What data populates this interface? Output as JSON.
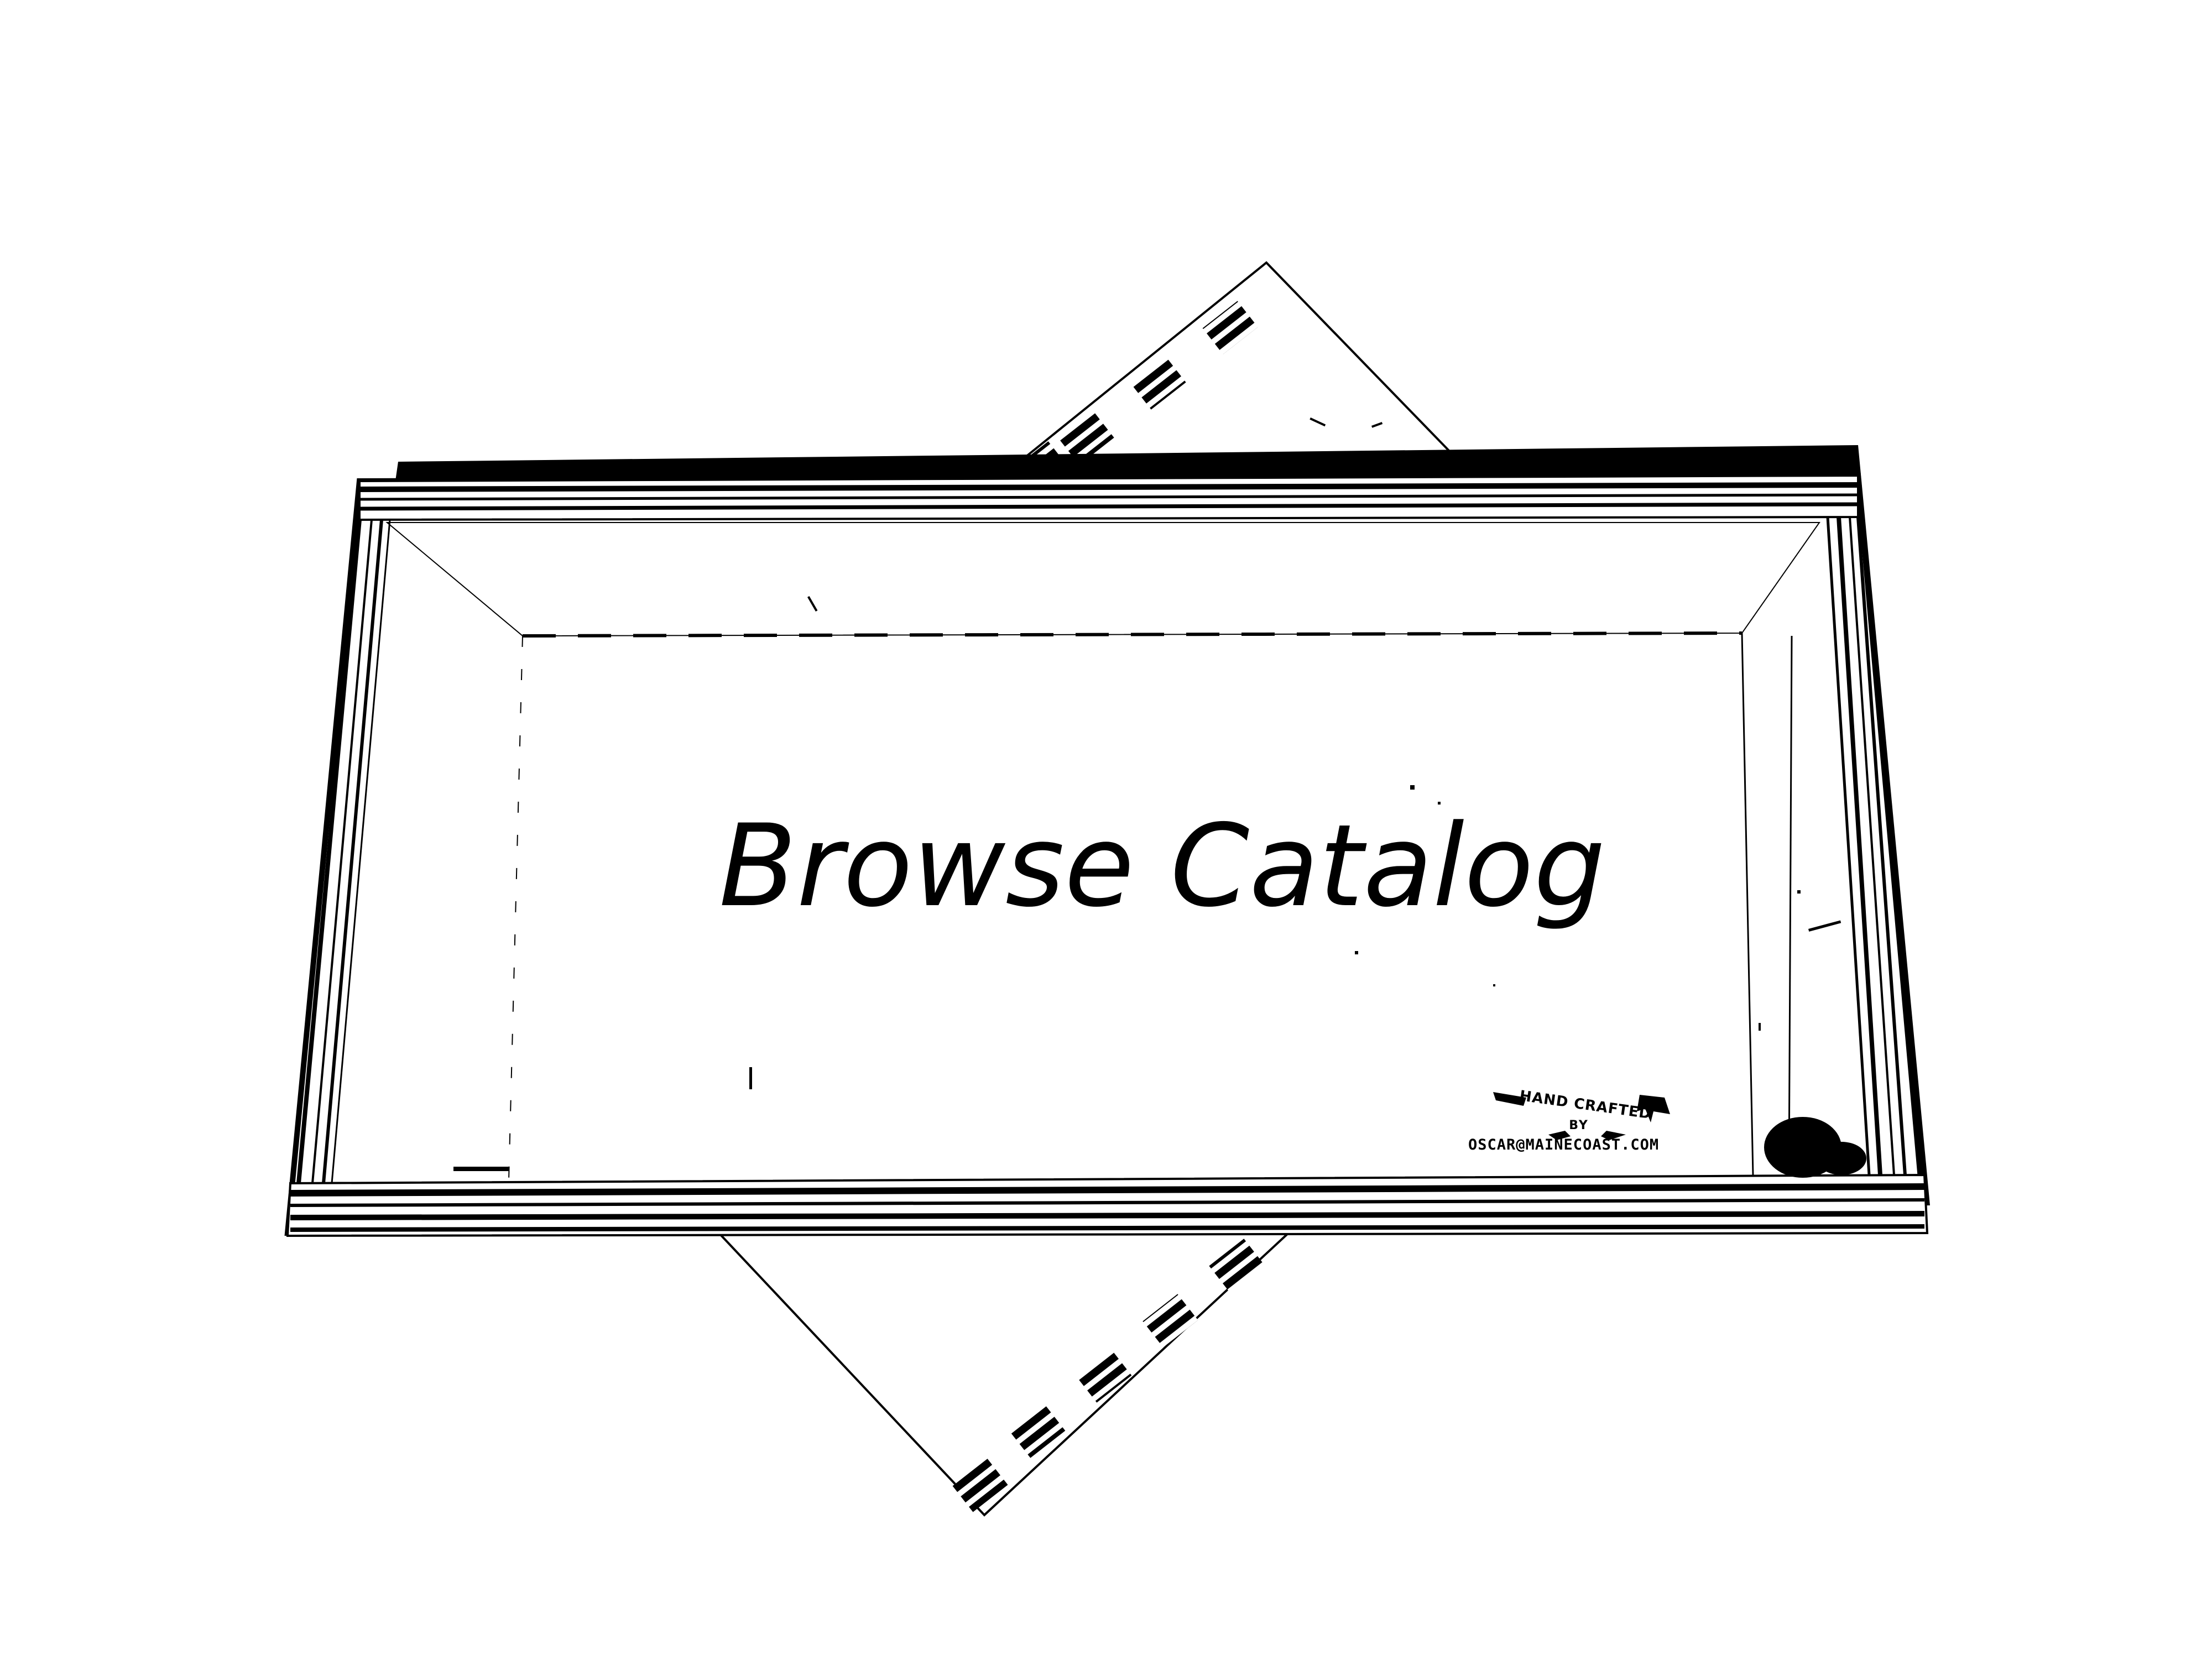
{
  "catalog_button": {
    "label": "Browse Catalog"
  },
  "maker_stamp": {
    "line1": "HAND CRAFTED",
    "line2": "BY",
    "line3": "OSCAR@MAINECOAST.COM"
  },
  "colors": {
    "ink": "#000000",
    "paper": "#ffffff"
  }
}
